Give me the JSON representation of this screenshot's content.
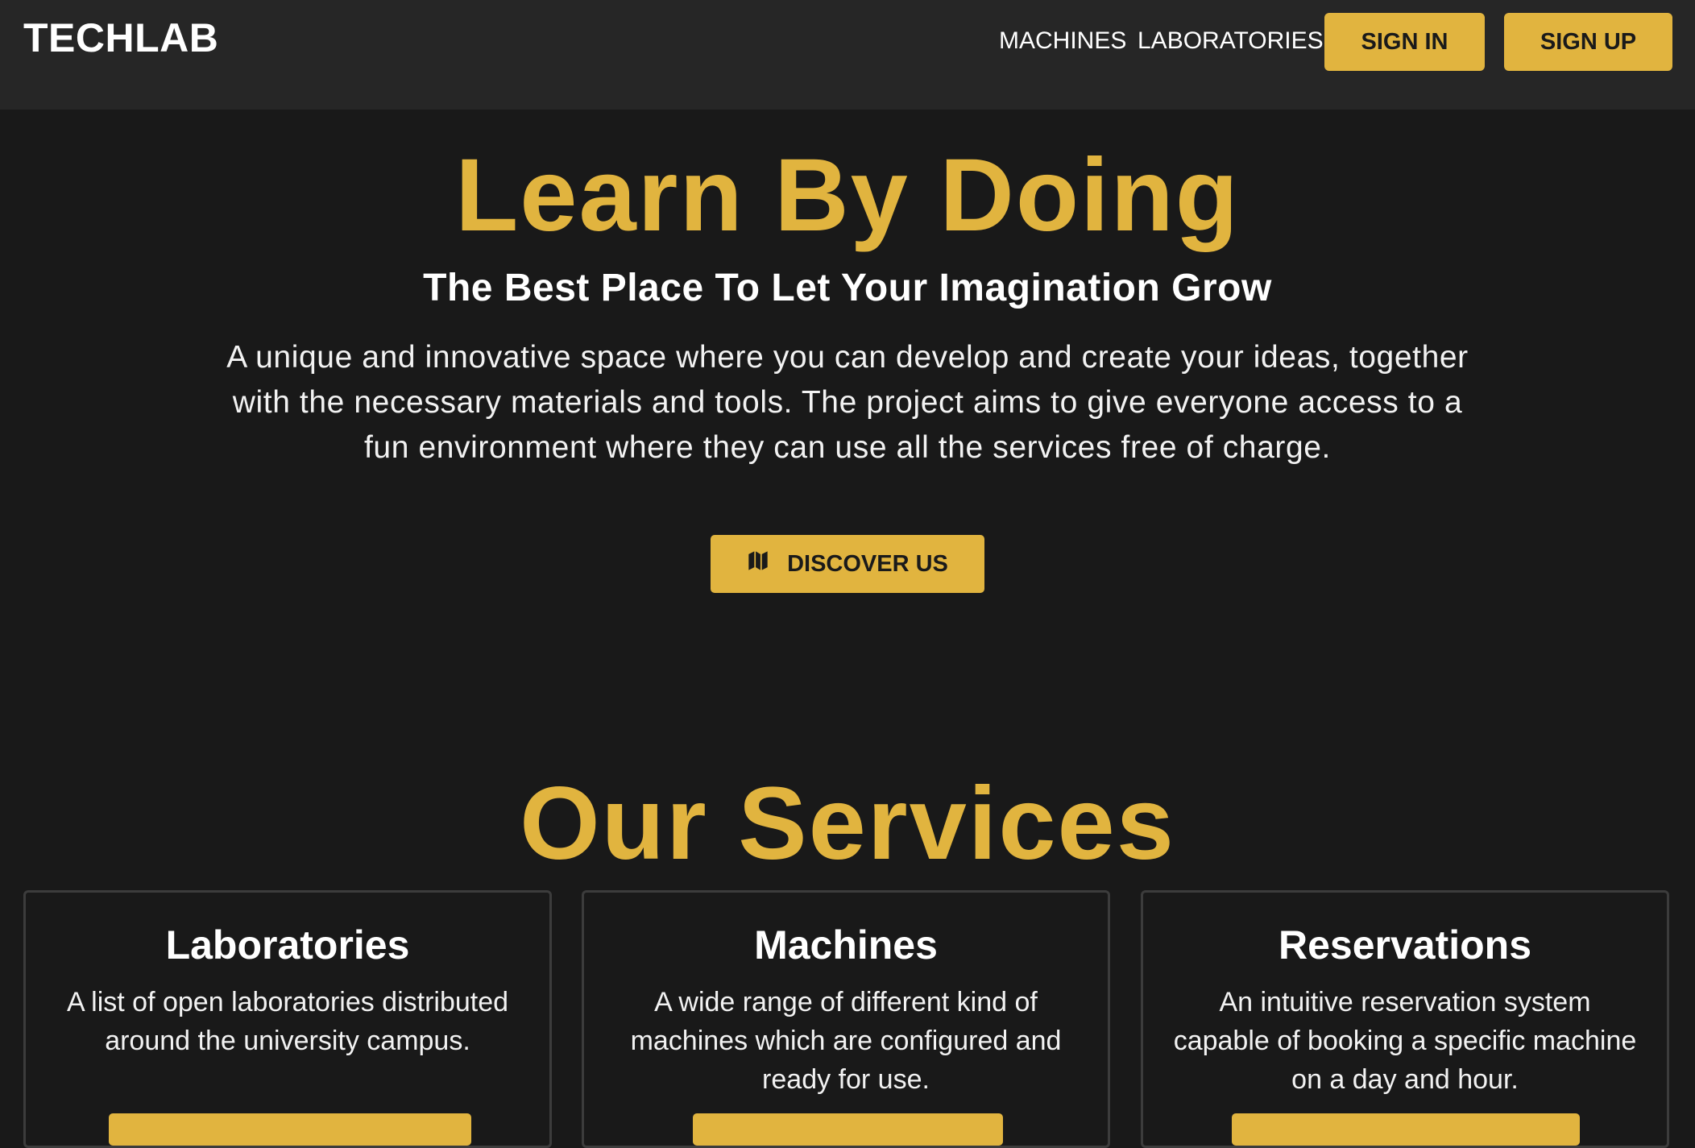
{
  "brand": "TECHLAB",
  "nav": {
    "machines": "MACHINES",
    "laboratories": "LABORATORIES",
    "sign_in": "SIGN IN",
    "sign_up": "SIGN UP"
  },
  "hero": {
    "title": "Learn By Doing",
    "subtitle": "The Best Place To Let Your Imagination Grow",
    "description": "A unique and innovative space where you can develop and create your ideas, together with the necessary materials and tools. The project aims to give everyone access to a fun environment where they can use all the services free of charge.",
    "cta_label": "DISCOVER US",
    "cta_icon": "map-icon"
  },
  "services": {
    "title": "Our Services",
    "cards": [
      {
        "title": "Laboratories",
        "description": "A list of open laboratories distributed around the university campus."
      },
      {
        "title": "Machines",
        "description": "A wide range of different kind of machines which are configured and ready for use."
      },
      {
        "title": "Reservations",
        "description": "An intuitive reservation system capable of booking a specific machine on a day and hour."
      }
    ]
  },
  "colors": {
    "accent": "#e1b43f",
    "background": "#191919",
    "navbar": "#262626",
    "card_border": "#3c3c3c"
  }
}
